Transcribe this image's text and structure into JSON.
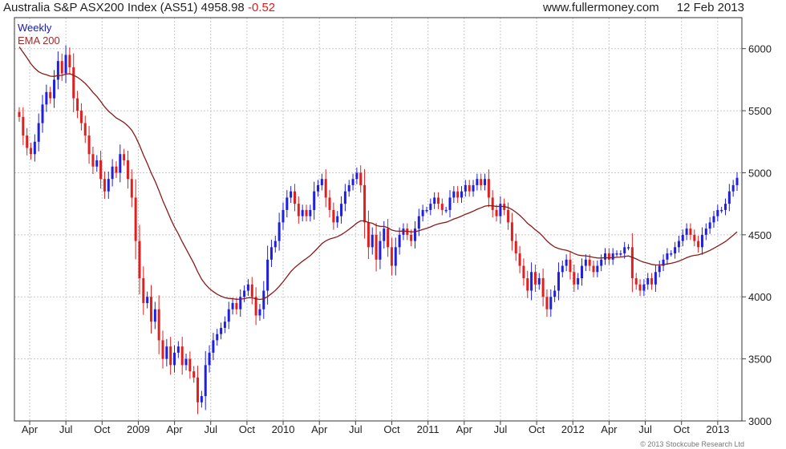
{
  "header": {
    "title": "Australia S&P ASX200 Index (AS51)",
    "last": "4958.98",
    "change": "-0.52",
    "site": "www.fullermoney.com",
    "date": "12 Feb 2013"
  },
  "legend": {
    "period": "Weekly",
    "indicator": "EMA 200"
  },
  "copyright": "© 2013 Stockcube Research Ltd",
  "colors": {
    "up": "#1f1fe0",
    "down": "#e01f1f",
    "ema": "#8b1a1a",
    "grid": "#c8c8c8"
  },
  "chart_data": {
    "type": "candlestick",
    "period": "weekly",
    "x_tick_labels": [
      "Apr",
      "Jul",
      "Oct",
      "2009",
      "Apr",
      "Jul",
      "Oct",
      "2010",
      "Apr",
      "Jul",
      "Oct",
      "2011",
      "Apr",
      "Jul",
      "Oct",
      "2012",
      "Apr",
      "Jul",
      "Oct",
      "2013"
    ],
    "y_tick_labels": [
      3000,
      3500,
      4000,
      4500,
      5000,
      5500,
      6000
    ],
    "ylim": [
      3000,
      6250
    ],
    "close": [
      5450,
      5300,
      5200,
      5150,
      5250,
      5400,
      5550,
      5650,
      5600,
      5750,
      5900,
      5800,
      5950,
      5850,
      5600,
      5500,
      5400,
      5300,
      5150,
      5050,
      5100,
      4950,
      4850,
      4950,
      5050,
      5000,
      5150,
      5100,
      4950,
      4800,
      4450,
      4150,
      3950,
      4000,
      3800,
      3900,
      3650,
      3500,
      3600,
      3450,
      3550,
      3600,
      3450,
      3500,
      3400,
      3350,
      3150,
      3200,
      3450,
      3550,
      3650,
      3700,
      3750,
      3800,
      3900,
      3950,
      3900,
      4000,
      4050,
      4100,
      4000,
      3850,
      3900,
      4050,
      4300,
      4400,
      4450,
      4600,
      4700,
      4800,
      4850,
      4750,
      4650,
      4700,
      4650,
      4700,
      4850,
      4900,
      4950,
      4800,
      4700,
      4600,
      4650,
      4750,
      4850,
      4900,
      4950,
      5000,
      4900,
      4600,
      4400,
      4500,
      4300,
      4450,
      4550,
      4400,
      4250,
      4400,
      4500,
      4550,
      4500,
      4450,
      4550,
      4650,
      4700,
      4700,
      4750,
      4800,
      4750,
      4700,
      4700,
      4800,
      4850,
      4800,
      4850,
      4900,
      4850,
      4900,
      4950,
      4900,
      4950,
      4800,
      4700,
      4650,
      4750,
      4700,
      4600,
      4450,
      4350,
      4250,
      4150,
      4050,
      4200,
      4100,
      4150,
      4000,
      3900,
      4000,
      4050,
      4200,
      4250,
      4300,
      4200,
      4100,
      4150,
      4250,
      4300,
      4250,
      4200,
      4250,
      4300,
      4350,
      4300,
      4350,
      4350,
      4350,
      4400,
      4400,
      4150,
      4100,
      4050,
      4100,
      4150,
      4100,
      4200,
      4250,
      4300,
      4350,
      4350,
      4400,
      4450,
      4500,
      4550,
      4500,
      4450,
      4400,
      4500,
      4550,
      4600,
      4650,
      4700,
      4700,
      4750,
      4850,
      4900,
      4959
    ]
  }
}
